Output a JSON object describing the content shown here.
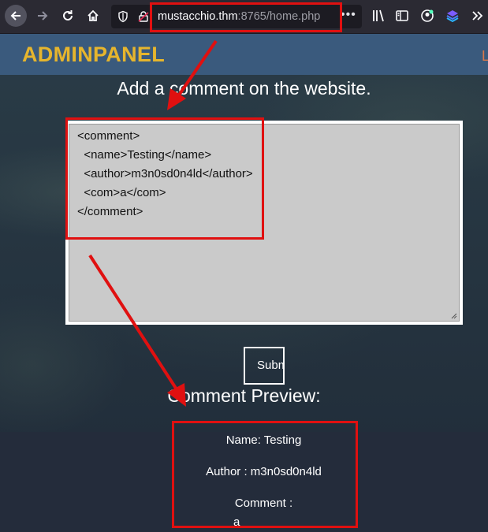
{
  "browser": {
    "url_host": "mustacchio.thm",
    "url_rest": ":8765/home.php",
    "url_more": "•••"
  },
  "nav": {
    "brand": "ADMINPANEL",
    "link_fragment": "L"
  },
  "form": {
    "heading": "Add a comment on the website.",
    "xml_lines": [
      "<comment>",
      "  <name>Testing</name>",
      "  <author>m3n0sd0n4ld</author>",
      "  <com>a</com>",
      "</comment>"
    ],
    "submit_label": "Submit"
  },
  "preview": {
    "title": "Comment Preview:",
    "name_line": "Name: Testing",
    "author_line": "Author : m3n0sd0n4ld",
    "comment_label": "Comment :",
    "comment_value": "a"
  },
  "colors": {
    "brand": "#e6b52d",
    "navbar": "#3a5a7d",
    "annotation": "#e01010"
  },
  "icons": [
    "back-arrow-icon",
    "forward-arrow-icon",
    "reload-icon",
    "home-icon",
    "shield-icon",
    "lock-icon",
    "library-icon",
    "sidebar-icon",
    "account-icon",
    "extension-icon",
    "overflow-icon"
  ]
}
